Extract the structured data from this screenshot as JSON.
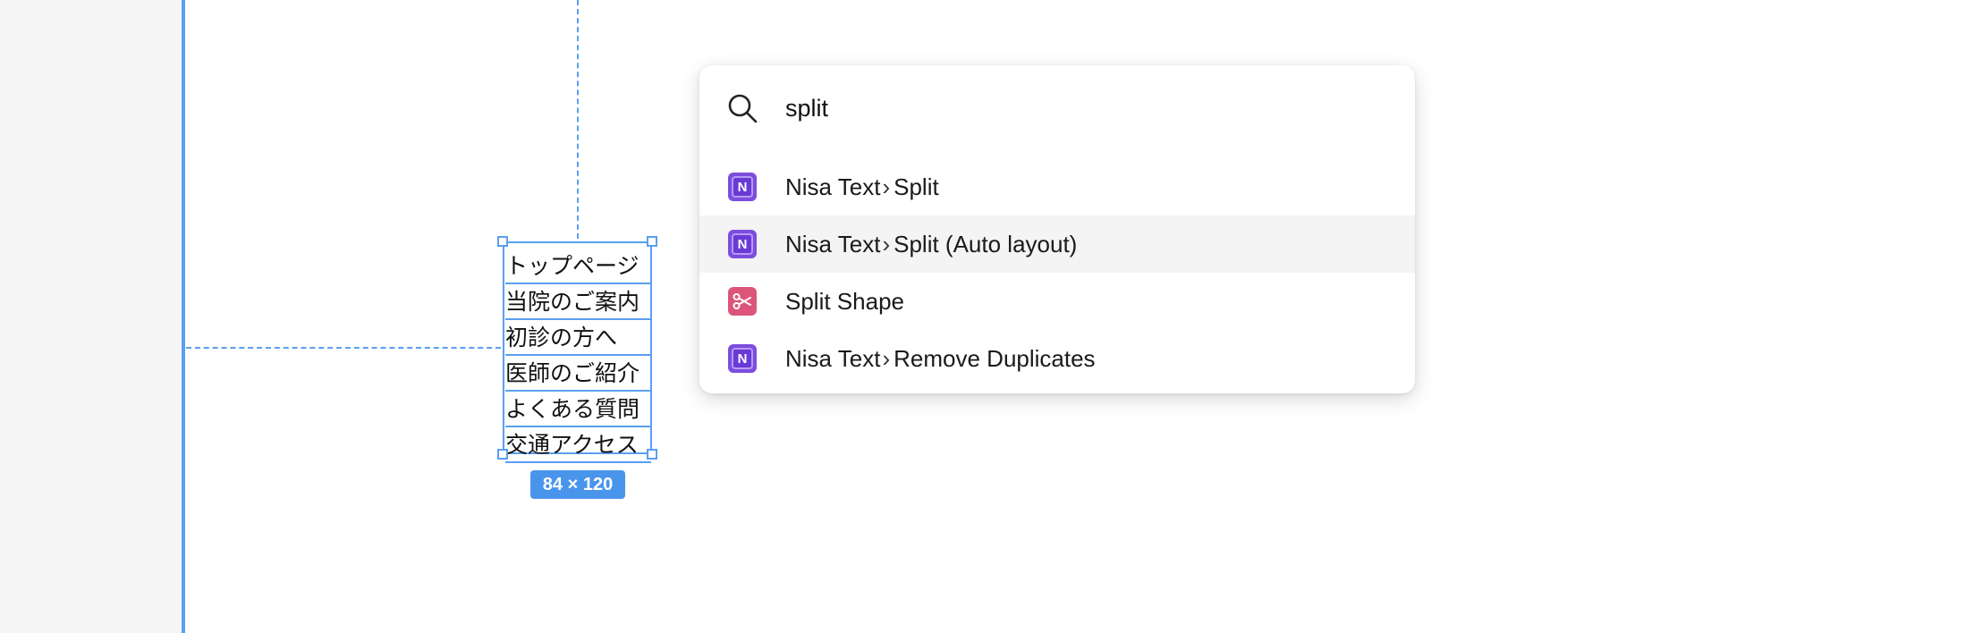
{
  "canvas": {
    "text_lines": [
      "トップページ",
      "当院のご案内",
      "初診の方へ",
      "医師のご紹介",
      "よくある質問",
      "交通アクセス"
    ],
    "size_label": "84 × 120"
  },
  "palette": {
    "search": {
      "value": "split",
      "icon": "search-icon"
    },
    "results": [
      {
        "plugin": "Nisa Text",
        "separator": "›",
        "command": "Split",
        "icon": "nisa-text-icon"
      },
      {
        "plugin": "Nisa Text",
        "separator": "›",
        "command": "Split (Auto layout)",
        "icon": "nisa-text-icon",
        "highlighted": true
      },
      {
        "plugin": "",
        "separator": "",
        "command": "Split Shape",
        "icon": "scissors-icon"
      },
      {
        "plugin": "Nisa Text",
        "separator": "›",
        "command": "Remove Duplicates",
        "icon": "nisa-text-icon"
      }
    ]
  },
  "colors": {
    "selection": "#5a9ff0",
    "nisa_badge": "#7c4ddf",
    "split_badge": "#dc5579",
    "highlight_row": "#f4f4f4"
  }
}
